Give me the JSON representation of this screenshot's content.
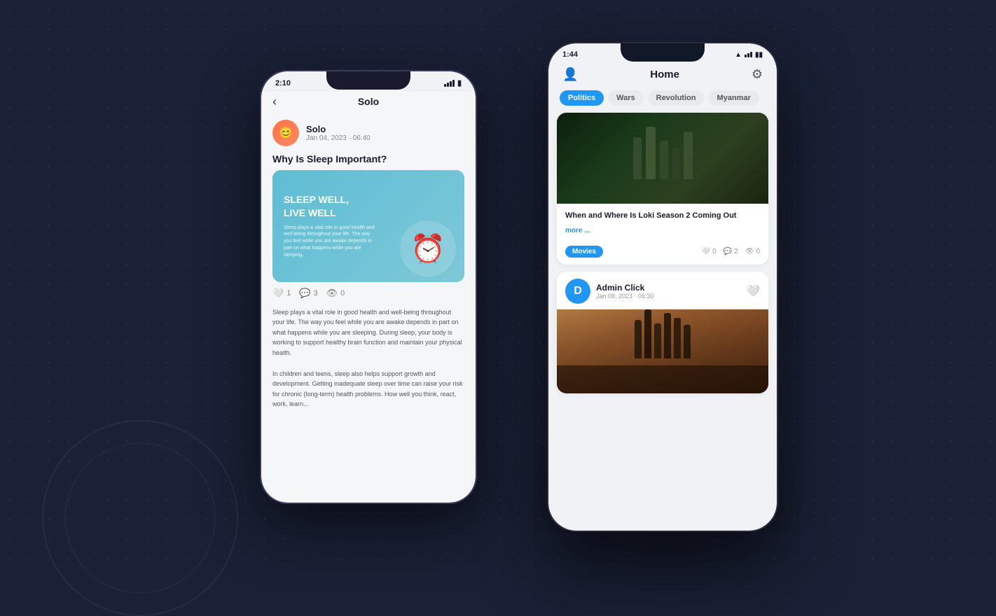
{
  "background": {
    "color": "#1a2035"
  },
  "phone_back": {
    "status_bar": {
      "time": "2:10",
      "battery": "🔋"
    },
    "nav": {
      "back_label": "‹",
      "title": "Solo"
    },
    "post": {
      "author": "Solo",
      "date": "Jan 04, 2023 · 06:40",
      "title": "Why Is Sleep Important?",
      "sleep_card_title": "SLEEP WELL,\nLIVE WELL",
      "sleep_card_text": "Sleep plays a vital role in good health and well-being throughout your life. The way you feel while you are awake depends in part on what happens while you are sleeping.",
      "likes": "1",
      "comments": "3",
      "views": "0",
      "body_text_1": "Sleep plays a vital role in good health and well-being throughout your life. The way you feel while you are awake depends in part on what happens while you are sleeping. During sleep, your body is working to support healthy brain function and maintain your physical health.",
      "body_text_2": "In children and teens, sleep also helps support growth and development. Getting inadequate sleep over time can raise your risk for chronic (long-term) health problems. How well you think, react, work, learn..."
    }
  },
  "phone_front": {
    "status_bar": {
      "time": "1:44",
      "wifi": "📶",
      "battery": "🔋"
    },
    "nav": {
      "profile_icon": "👤",
      "title": "Home",
      "settings_icon": "⚙"
    },
    "categories": [
      {
        "label": "Politics",
        "active": true
      },
      {
        "label": "Wars",
        "active": false
      },
      {
        "label": "Revolution",
        "active": false
      },
      {
        "label": "Myanmar",
        "active": false
      }
    ],
    "news_card": {
      "title": "When and Where Is Loki Season 2 Coming Out",
      "more_label": "more ...",
      "tag": "Movies",
      "likes": "0",
      "comments": "2",
      "views": "0"
    },
    "admin_post": {
      "author": "Admin Click",
      "date": "Jan 08, 2023 · 06:30",
      "avatar_letter": "D"
    }
  }
}
